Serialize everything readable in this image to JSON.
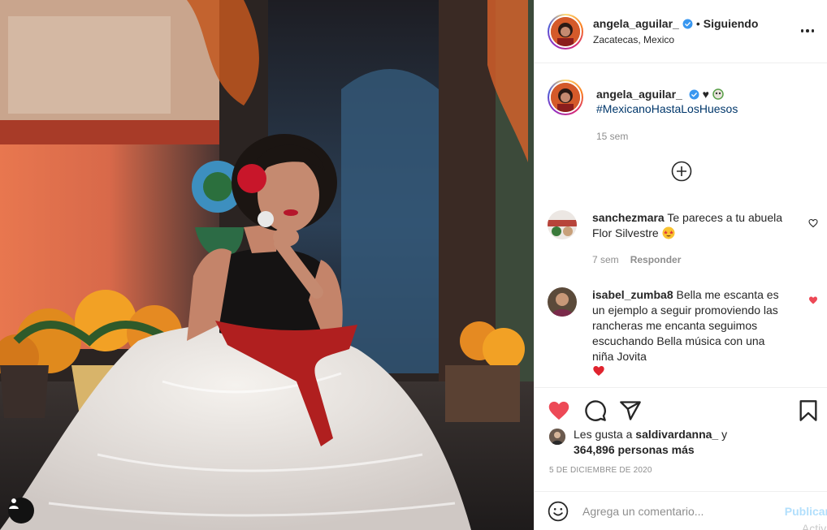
{
  "post": {
    "username": "angela_aguilar_",
    "separator": "•",
    "follow_status": "Siguiendo",
    "location": "Zacatecas, Mexico",
    "caption_prefix": "♥︎",
    "caption_hashtag": "#MexicanoHastaLosHuesos",
    "caption_time": "15 sem"
  },
  "comments": [
    {
      "username": "sanchezmara",
      "text": "Te pareces a tu abuela Flor Silvestre",
      "time": "7 sem",
      "reply_label": "Responder",
      "liked": false
    },
    {
      "username": "isabel_zumba8",
      "text": "Bella me escanta es un ejemplo a seguir promoviendo las rancheras me encanta seguimos escuchando Bella música con una niña Jovita",
      "liked": true
    }
  ],
  "likes": {
    "prefix": "Les gusta a",
    "first_user": "saldivardanna_",
    "connector": "y",
    "count_text": "364,896 personas más"
  },
  "date": "5 DE DICIEMBRE DE 2020",
  "comment_box": {
    "placeholder": "Agrega un comentario...",
    "publish_label": "Publicar"
  },
  "watermark": "Activa",
  "colors": {
    "like_red": "#ed4956",
    "hashtag_blue": "#00376b",
    "publish_disabled": "#b2dffc",
    "secondary_text": "#8e8e8e"
  },
  "icons": [
    "tag-user-icon",
    "verified-badge-icon",
    "more-options-icon",
    "load-more-icon",
    "heart-outline-icon",
    "heart-filled-icon",
    "comment-icon",
    "share-icon",
    "bookmark-icon",
    "emoji-icon"
  ]
}
